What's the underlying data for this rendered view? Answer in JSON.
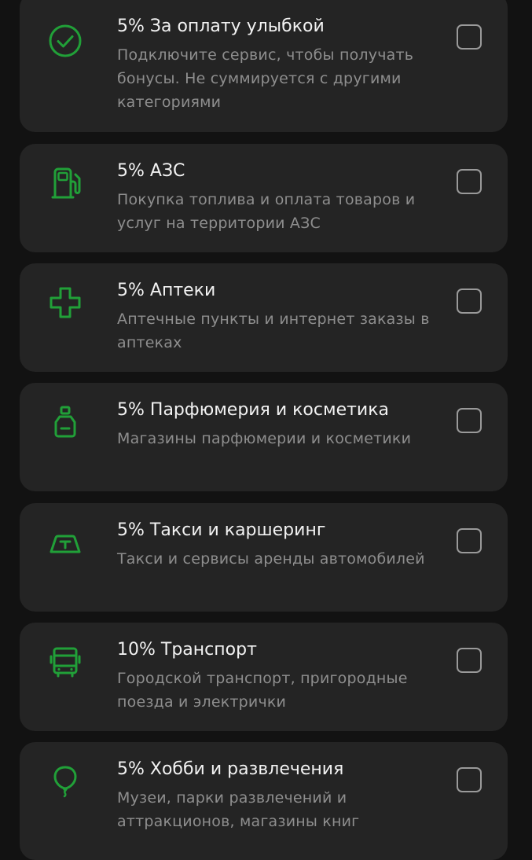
{
  "colors": {
    "background": "#121212",
    "card": "#242424",
    "accent_green": "#21A038",
    "title_text": "#F2F2F2",
    "description_text": "#8E8E8E",
    "checkbox_border": "#9A9A9A"
  },
  "categories": [
    {
      "icon": "check-circle-icon",
      "title": "5% За оплату улыбкой",
      "description": "Подключите сервис, чтобы получать бонусы. Не суммируется с другими категориями",
      "checked": false
    },
    {
      "icon": "fuel-pump-icon",
      "title": "5% АЗС",
      "description": "Покупка топлива и оплата товаров и услуг на территории АЗС",
      "checked": false
    },
    {
      "icon": "medical-cross-icon",
      "title": "5% Аптеки",
      "description": "Аптечные пункты и интернет заказы в аптеках",
      "checked": false
    },
    {
      "icon": "perfume-bottle-icon",
      "title": "5% Парфюмерия и косметика",
      "description": "Магазины парфюмерии и косметики",
      "checked": false
    },
    {
      "icon": "taxi-sign-icon",
      "title": "5% Такси и каршеринг",
      "description": "Такси и сервисы аренды автомобилей",
      "checked": false
    },
    {
      "icon": "bus-icon",
      "title": "10% Транспорт",
      "description": "Городской транспорт, пригородные поезда и электрички",
      "checked": false
    },
    {
      "icon": "balloon-icon",
      "title": "5% Хобби и развлечения",
      "description": "Музеи, парки развлечений и аттракционов, магазины книг",
      "checked": false
    }
  ]
}
